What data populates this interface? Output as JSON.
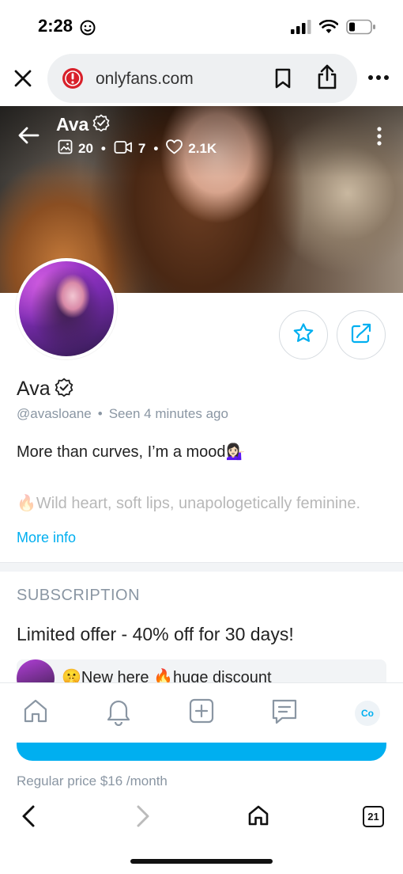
{
  "status_bar": {
    "time": "2:28"
  },
  "browser": {
    "url": "onlyfans.com"
  },
  "cover": {
    "name": "Ava",
    "photos_count": "20",
    "videos_count": "7",
    "likes_count": "2.1K",
    "separator": "•"
  },
  "profile": {
    "name": "Ava",
    "handle": "@avasloane",
    "separator": "•",
    "seen": "Seen  4 minutes ago",
    "bio_line1": "More than curves, I’m a mood💁🏻‍♀️",
    "bio_line2": "🔥Wild heart, soft lips, unapologetically feminine.",
    "more_info": "More info"
  },
  "subscription": {
    "heading": "SUBSCRIPTION",
    "offer": "Limited offer - 40% off for 30 days!",
    "promo_message": "🤫New here 🔥huge discount",
    "regular_price": "Regular price $16 /month"
  },
  "app_nav": {
    "avatar_initials": "Co"
  },
  "safari": {
    "tabs_count": "21"
  },
  "colors": {
    "accent": "#00aff0",
    "muted": "#8a96a3",
    "text": "#222222"
  }
}
